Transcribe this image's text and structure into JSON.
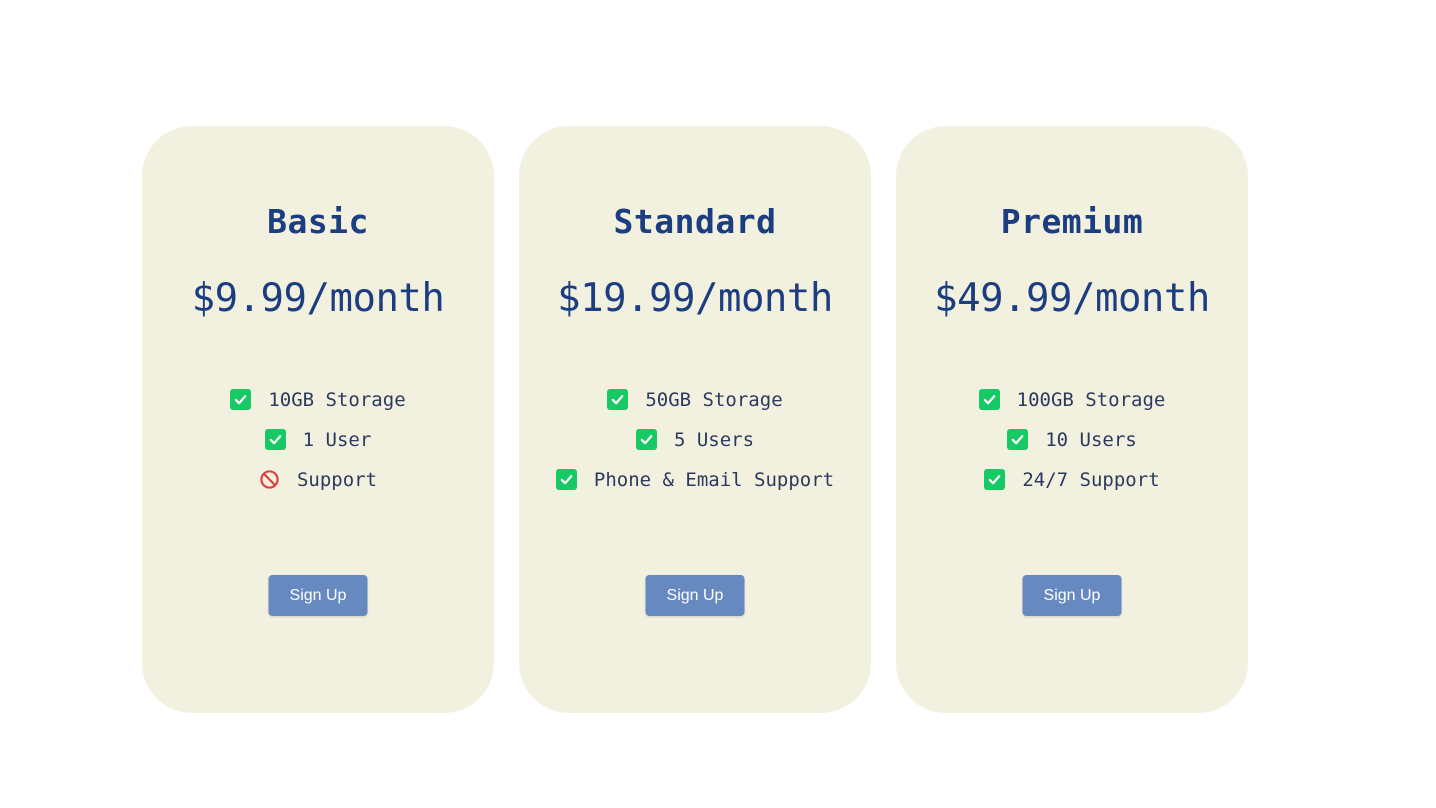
{
  "colors": {
    "card_background": "#f2f1e0",
    "heading": "#1c3d7f",
    "check": "#17c964",
    "not_included": "#e03a3a",
    "button": "#6689c0"
  },
  "plans": [
    {
      "name": "Basic",
      "price": "$9.99/month",
      "features": [
        {
          "label": "10GB Storage",
          "icon": "check-icon",
          "included": true
        },
        {
          "label": "1 User",
          "icon": "check-icon",
          "included": true
        },
        {
          "label": "Support",
          "icon": "blocked-icon",
          "included": false
        }
      ],
      "button_label": "Sign Up"
    },
    {
      "name": "Standard",
      "price": "$19.99/month",
      "features": [
        {
          "label": "50GB Storage",
          "icon": "check-icon",
          "included": true
        },
        {
          "label": "5 Users",
          "icon": "check-icon",
          "included": true
        },
        {
          "label": "Phone & Email Support",
          "icon": "check-icon",
          "included": true
        }
      ],
      "button_label": "Sign Up"
    },
    {
      "name": "Premium",
      "price": "$49.99/month",
      "features": [
        {
          "label": "100GB Storage",
          "icon": "check-icon",
          "included": true
        },
        {
          "label": "10 Users",
          "icon": "check-icon",
          "included": true
        },
        {
          "label": "24/7 Support",
          "icon": "check-icon",
          "included": true
        }
      ],
      "button_label": "Sign Up"
    }
  ]
}
